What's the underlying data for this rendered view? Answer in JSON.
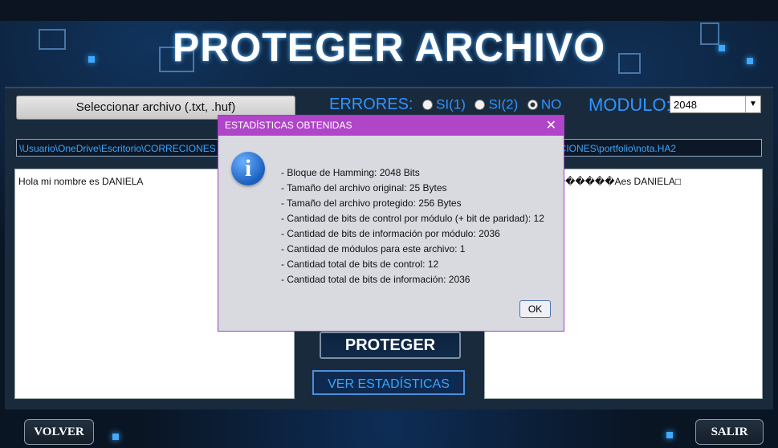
{
  "window": {
    "title": "PROTEGER ARCHIVO"
  },
  "controls": {
    "select_file_label": "Seleccionar archivo (.txt, .huf)",
    "errores_label": "ERRORES:",
    "radio_options": [
      {
        "label": "SI(1)",
        "selected": false
      },
      {
        "label": "SI(2)",
        "selected": false
      },
      {
        "label": "NO",
        "selected": true
      }
    ],
    "modulo_label": "MODULO:",
    "modulo_value": "2048",
    "modulo_arrow": "▼"
  },
  "paths": {
    "input": "\\Usuario\\OneDrive\\Escritorio\\CORRECIONES",
    "output": "scritorio\\CORRECIONES\\portfolio\\nota.HA2"
  },
  "text_areas": {
    "input": "Hola mi nombre es DANIELA",
    "output": "�{c����@������Aes DANIELA□"
  },
  "buttons": {
    "proteger": "PROTEGER",
    "ver_estadisticas": "VER ESTADÍSTICAS",
    "volver": "VOLVER",
    "salir": "SALIR"
  },
  "dialog": {
    "title": "ESTADÍSTICAS OBTENIDAS",
    "close": "✕",
    "icon": "info-icon",
    "icon_glyph": "i",
    "lines": [
      "- Bloque de Hamming: 2048 Bits",
      "- Tamaño del archivo original: 25 Bytes",
      "- Tamaño del archivo protegido: 256 Bytes",
      "- Cantidad de bits de control por módulo (+ bit de paridad): 12",
      "- Cantidad de bits de información por módulo: 2036",
      "- Cantidad de módulos para este archivo: 1",
      "- Cantidad total de bits de control: 12",
      "- Cantidad total de bits de información: 2036"
    ],
    "ok": "OK"
  },
  "colors": {
    "accent": "#2f95ff",
    "dialog_title_bg": "#b045c9"
  }
}
